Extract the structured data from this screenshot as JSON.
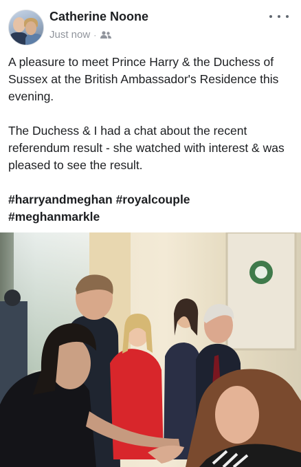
{
  "post": {
    "author": "Catherine Noone",
    "timestamp": "Just now",
    "separator": "·",
    "audience_icon": "friends-icon",
    "more_icon": "more-options-icon",
    "paragraphs": [
      "A pleasure to meet Prince Harry & the Duchess of Sussex at the British Ambassador's Residence this evening.",
      "The Duchess & I had a chat about the recent referendum result - she watched with interest & was pleased to see the result."
    ],
    "hashtags_line1": "#harryandmeghan #royalcouple",
    "hashtags_line2": "#meghanmarkle"
  },
  "colors": {
    "text": "#1c1e21",
    "meta": "#90949c",
    "background": "#ffffff"
  }
}
